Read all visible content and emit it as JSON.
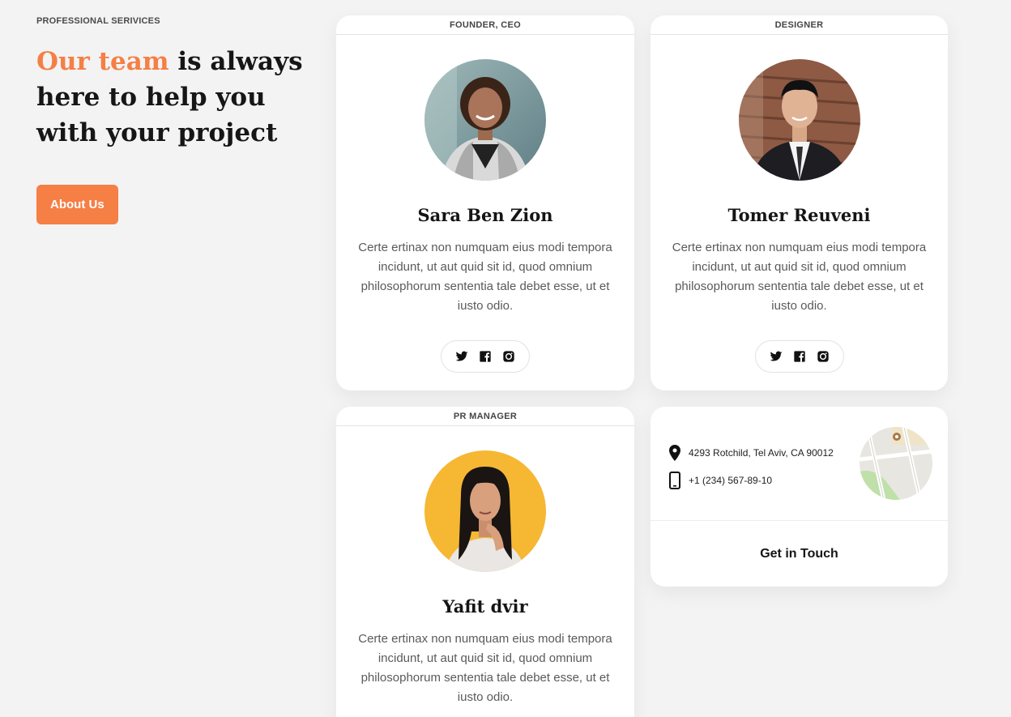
{
  "intro": {
    "eyebrow": "PROFESSIONAL SERIVICES",
    "headline_accent": "Our team",
    "headline_rest": " is always here to help you with your project",
    "button_label": "About Us"
  },
  "team": [
    {
      "role": "FOUNDER, CEO",
      "name": "Sara Ben Zion",
      "bio": "Certe ertinax non numquam eius modi tempora incidunt, ut aut quid sit id, quod omnium philosophorum sententia tale debet esse, ut et iusto odio.",
      "socials": [
        "twitter-icon",
        "facebook-icon",
        "instagram-icon"
      ]
    },
    {
      "role": "DESIGNER",
      "name": "Tomer Reuveni",
      "bio": "Certe ertinax non numquam eius modi tempora incidunt, ut aut quid sit id, quod omnium philosophorum sententia tale debet esse, ut et iusto odio.",
      "socials": [
        "twitter-icon",
        "facebook-icon",
        "instagram-icon"
      ]
    },
    {
      "role": "PR MANAGER",
      "name": "Yafit dvir",
      "bio": "Certe ertinax non numquam eius modi tempora incidunt, ut aut quid sit id, quod omnium philosophorum sententia tale debet esse, ut et iusto odio."
    }
  ],
  "contact": {
    "address": "4293 Rotchild, Tel Aviv, CA 90012",
    "phone": "+1 (234) 567-89-10",
    "cta": "Get in Touch"
  },
  "colors": {
    "accent": "#f57f45",
    "background": "#f3f3f3",
    "card": "#ffffff"
  }
}
